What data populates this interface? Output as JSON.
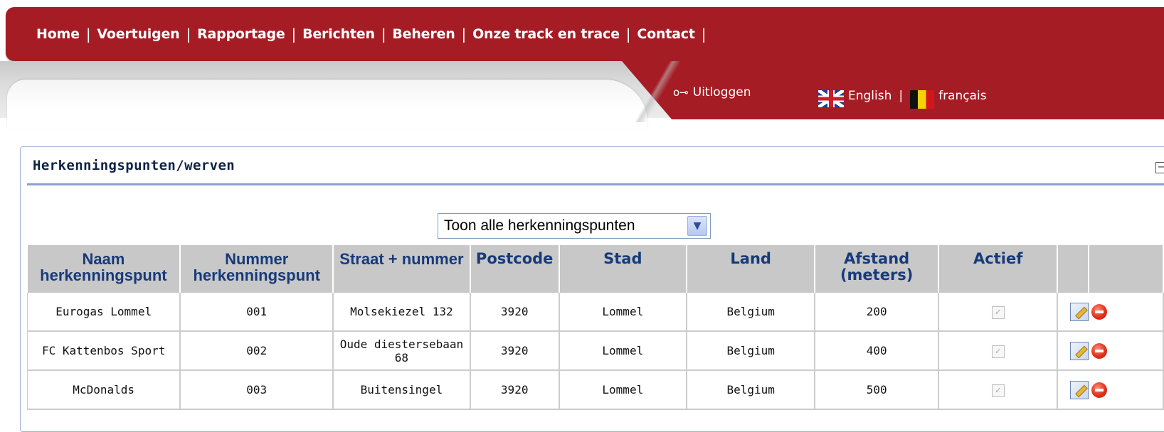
{
  "nav": {
    "items": [
      "Home",
      "Voertuigen",
      "Rapportage",
      "Berichten",
      "Beheren",
      "Onze track en trace",
      "Contact"
    ]
  },
  "subnav": {
    "logout": "Uitloggen",
    "lang_en": "English",
    "lang_fr": "français"
  },
  "panel": {
    "title": "Herkenningspunten/werven",
    "filter": "Toon alle herkenningspunten"
  },
  "table": {
    "headers": {
      "name": "Naam herkenningspunt",
      "number": "Nummer herkenningspunt",
      "street": "Straat + nummer",
      "postcode": "Postcode",
      "city": "Stad",
      "country": "Land",
      "distance": "Afstand (meters)",
      "active": "Actief"
    },
    "rows": [
      {
        "name": "Eurogas Lommel",
        "number": "001",
        "street": "Molsekiezel 132",
        "postcode": "3920",
        "city": "Lommel",
        "country": "Belgium",
        "distance": "200",
        "active": true
      },
      {
        "name": "FC Kattenbos Sport",
        "number": "002",
        "street": "Oude diestersebaan 68",
        "postcode": "3920",
        "city": "Lommel",
        "country": "Belgium",
        "distance": "400",
        "active": true
      },
      {
        "name": "McDonalds",
        "number": "003",
        "street": "Buitensingel",
        "postcode": "3920",
        "city": "Lommel",
        "country": "Belgium",
        "distance": "500",
        "active": true
      }
    ]
  },
  "colors": {
    "brand_red": "#a61c24",
    "header_text": "#173a7a",
    "header_bg": "#c8c8c8"
  },
  "icons": [
    "key-icon",
    "uk-flag-icon",
    "belgium-flag-icon",
    "collapse-icon",
    "dropdown-arrow-icon",
    "checkbox-icon",
    "edit-icon",
    "delete-icon"
  ]
}
